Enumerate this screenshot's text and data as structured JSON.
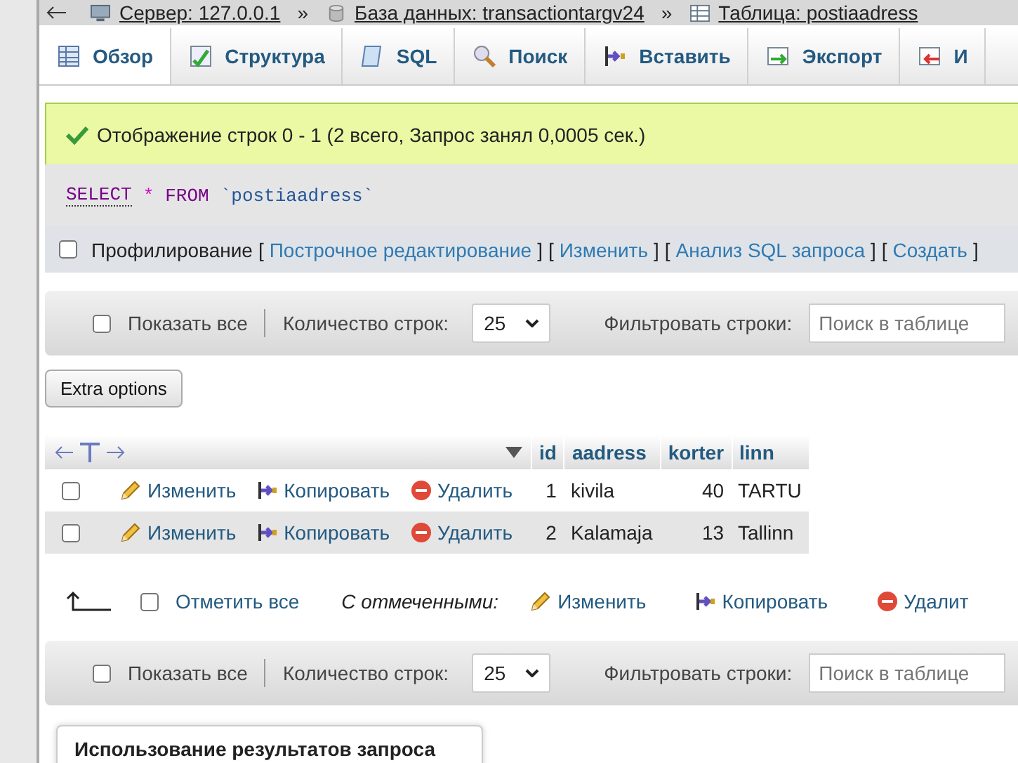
{
  "breadcrumb": [
    {
      "kind": "server",
      "label": "Сервер: 127.0.0.1"
    },
    {
      "kind": "database",
      "separator": "»",
      "label": "База данных: transactiontargv24"
    },
    {
      "kind": "table",
      "separator": "»",
      "label": "Таблица: postiaadress"
    }
  ],
  "tabs": [
    {
      "kind": "browse",
      "label": "Обзор",
      "selected": true
    },
    {
      "kind": "structure",
      "label": "Структура",
      "selected": false
    },
    {
      "kind": "sql",
      "label": "SQL",
      "selected": false
    },
    {
      "kind": "search",
      "label": "Поиск",
      "selected": false
    },
    {
      "kind": "insert",
      "label": "Вставить",
      "selected": false
    },
    {
      "kind": "export",
      "label": "Экспорт",
      "selected": false
    },
    {
      "kind": "import",
      "label": "И",
      "selected": false
    }
  ],
  "success_message": "Отображение строк 0 - 1 (2 всего, Запрос занял 0,0005 сек.)",
  "sql_query": [
    {
      "kind": "keyword",
      "text": "SELECT"
    },
    {
      "kind": "operator",
      "text": "*"
    },
    {
      "kind": "keyword",
      "text": "FROM"
    },
    {
      "kind": "identifier",
      "text": "`postiaadress`"
    }
  ],
  "profiling": {
    "label": "Профилирование",
    "checked": false,
    "links": [
      {
        "open": "[",
        "label": "Построчное редактирование",
        "close": "]"
      },
      {
        "open": "[",
        "label": "Изменить",
        "close": "]"
      },
      {
        "open": "[",
        "label": "Анализ SQL запроса",
        "close": "]"
      },
      {
        "open": "[",
        "label": "Создать",
        "close": "]"
      }
    ]
  },
  "nav_bars": [
    {
      "show_all_label": "Показать все",
      "show_all_checked": false,
      "rows_label": "Количество строк:",
      "rows_value": "25",
      "filter_label": "Фильтровать строки:",
      "filter_placeholder": "Поиск в таблице"
    },
    {
      "show_all_label": "Показать все",
      "show_all_checked": false,
      "rows_label": "Количество строк:",
      "rows_value": "25",
      "filter_label": "Фильтровать строки:",
      "filter_placeholder": "Поиск в таблице"
    }
  ],
  "extra_options_button": "Extra options",
  "table": {
    "columns": [
      "id",
      "aadress",
      "korter",
      "linn"
    ],
    "rows": [
      {
        "checked": false,
        "actions": [
          {
            "kind": "edit",
            "label": "Изменить"
          },
          {
            "kind": "copy",
            "label": "Копировать"
          },
          {
            "kind": "delete",
            "label": "Удалить"
          }
        ],
        "cells": [
          "1",
          "kivila",
          "40",
          "TARTU"
        ]
      },
      {
        "checked": false,
        "actions": [
          {
            "kind": "edit",
            "label": "Изменить"
          },
          {
            "kind": "copy",
            "label": "Копировать"
          },
          {
            "kind": "delete",
            "label": "Удалить"
          }
        ],
        "cells": [
          "2",
          "Kalamaja",
          "13",
          "Tallinn"
        ]
      }
    ]
  },
  "bulk_actions": {
    "check_all_label": "Отметить все",
    "checked": false,
    "with_selected_label": "С отмеченными:",
    "actions": [
      {
        "kind": "edit",
        "label": "Изменить"
      },
      {
        "kind": "copy",
        "label": "Копировать"
      },
      {
        "kind": "delete",
        "label": "Удалит"
      }
    ]
  },
  "query_results_panel": {
    "title": "Использование результатов запроса"
  }
}
